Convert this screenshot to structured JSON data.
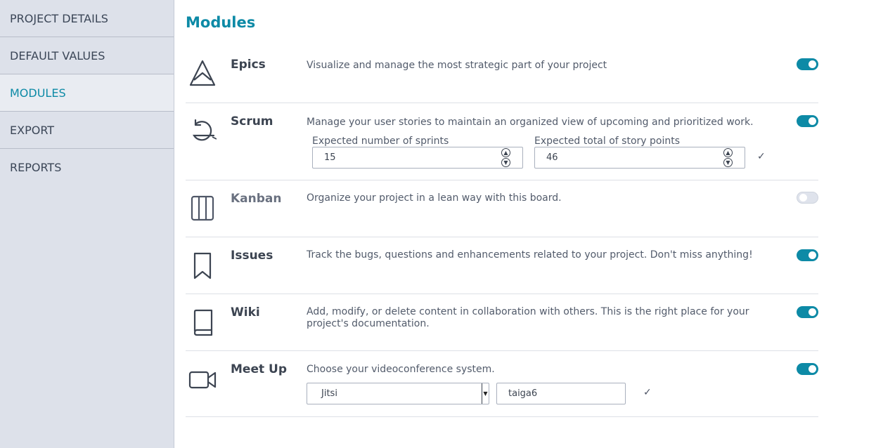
{
  "sidebar": {
    "items": [
      {
        "label": "PROJECT DETAILS"
      },
      {
        "label": "DEFAULT VALUES"
      },
      {
        "label": "MODULES"
      },
      {
        "label": "EXPORT"
      },
      {
        "label": "REPORTS"
      }
    ],
    "active": "MODULES"
  },
  "page": {
    "title": "Modules"
  },
  "modules": {
    "epics": {
      "name": "Epics",
      "description": "Visualize and manage the most strategic part of your project",
      "enabled": true,
      "icon": "mountain-icon"
    },
    "scrum": {
      "name": "Scrum",
      "description": "Manage your user stories to maintain an organized view of upcoming and prioritized work.",
      "enabled": true,
      "icon": "cycle-icon",
      "sprints_label": "Expected number of sprints",
      "sprints_value": "15",
      "points_label": "Expected total of story points",
      "points_value": "46"
    },
    "kanban": {
      "name": "Kanban",
      "description": "Organize your project in a lean way with this board.",
      "enabled": false,
      "icon": "columns-icon"
    },
    "issues": {
      "name": "Issues",
      "description": "Track the bugs, questions and enhancements related to your project. Don't miss anything!",
      "enabled": true,
      "icon": "bookmark-icon"
    },
    "wiki": {
      "name": "Wiki",
      "description": "Add, modify, or delete content in collaboration with others. This is the right place for your project's documentation.",
      "enabled": true,
      "icon": "book-icon"
    },
    "meetup": {
      "name": "Meet Up",
      "description": "Choose your videoconference system.",
      "enabled": true,
      "icon": "video-camera-icon",
      "system_value": "Jitsi",
      "room_value": "taiga6"
    }
  },
  "colors": {
    "accent": "#0d8aa6",
    "sidebar_bg": "#dde1ea",
    "text": "#3c4451"
  }
}
